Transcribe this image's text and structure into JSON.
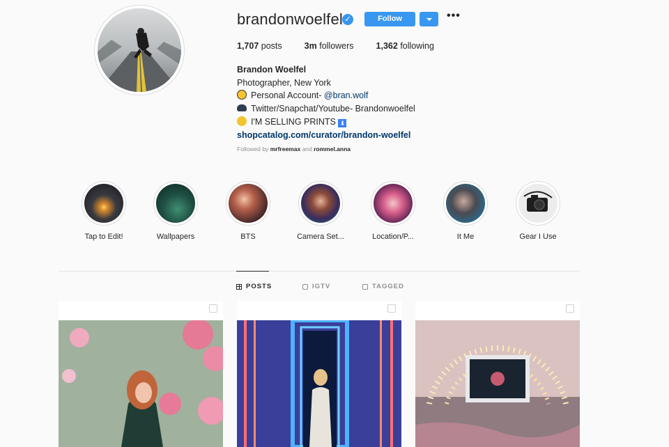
{
  "profile": {
    "username": "brandonwoelfel",
    "verified_glyph": "✓",
    "follow_label": "Follow",
    "more_label": "•••",
    "stats": [
      {
        "count": "1,707",
        "label": "posts"
      },
      {
        "count": "3m",
        "label": "followers"
      },
      {
        "count": "1,362",
        "label": "following"
      }
    ],
    "bio": {
      "name": "Brandon Woelfel",
      "line1": "Photographer, New York",
      "line2_prefix": "Personal Account- ",
      "line2_mention": "@bran.wolf",
      "line3": "Twitter/Snapchat/Youtube- Brandonwoelfel",
      "line4": "I'M SELLING PRINTS",
      "line4_badge": "⬇",
      "url": "shopcatalog.com/curator/brandon-woelfel"
    },
    "followed_by": {
      "prefix": "Followed by ",
      "user1": "mrfreemax",
      "conj": " and ",
      "user2": "rommel.anna"
    }
  },
  "highlights": [
    {
      "label": "Tap to Edit!"
    },
    {
      "label": "Wallpapers"
    },
    {
      "label": "BTS"
    },
    {
      "label": "Camera Set..."
    },
    {
      "label": "Location/P..."
    },
    {
      "label": "It Me"
    },
    {
      "label": "Gear I Use"
    }
  ],
  "tabs": [
    {
      "label": "POSTS",
      "icon": "grid-icon",
      "active": true
    },
    {
      "label": "IGTV",
      "icon": "igtv-icon",
      "active": false
    },
    {
      "label": "TAGGED",
      "icon": "tag-icon",
      "active": false
    }
  ],
  "colors": {
    "accent": "#3897f0",
    "link": "#00376b",
    "muted": "#8e8e8e"
  }
}
